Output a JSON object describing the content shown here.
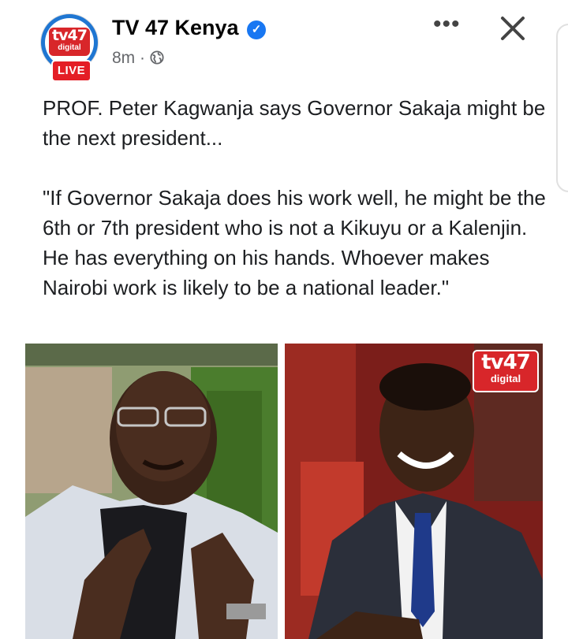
{
  "post": {
    "page_name": "TV 47 Kenya",
    "time": "8m",
    "separator": "·",
    "audience_icon": "globe-icon",
    "verified_icon": "verified-badge-icon",
    "live_badge": "LIVE",
    "more_icon": "more-options-icon",
    "more_label": "•••",
    "close_icon": "close-icon",
    "close_label": "✕",
    "avatar_logo": {
      "big": "tv47",
      "small": "digital"
    },
    "paragraphs": [
      "PROF. Peter Kagwanja says Governor Sakaja might be the next president...",
      "\"If Governor Sakaja does his work well, he might be the 6th or 7th president who is not a Kikuyu or a Kalenjin. He has everything on his hands. Whoever makes Nairobi work is likely to be a national leader.\""
    ],
    "photos": [
      {
        "name": "photo-left"
      },
      {
        "name": "photo-right",
        "watermark": {
          "big": "tv47",
          "small": "digital"
        }
      }
    ]
  },
  "colors": {
    "brand_red": "#d8262a",
    "verified_blue": "#1877f2",
    "avatar_ring": "#1f76d2"
  }
}
